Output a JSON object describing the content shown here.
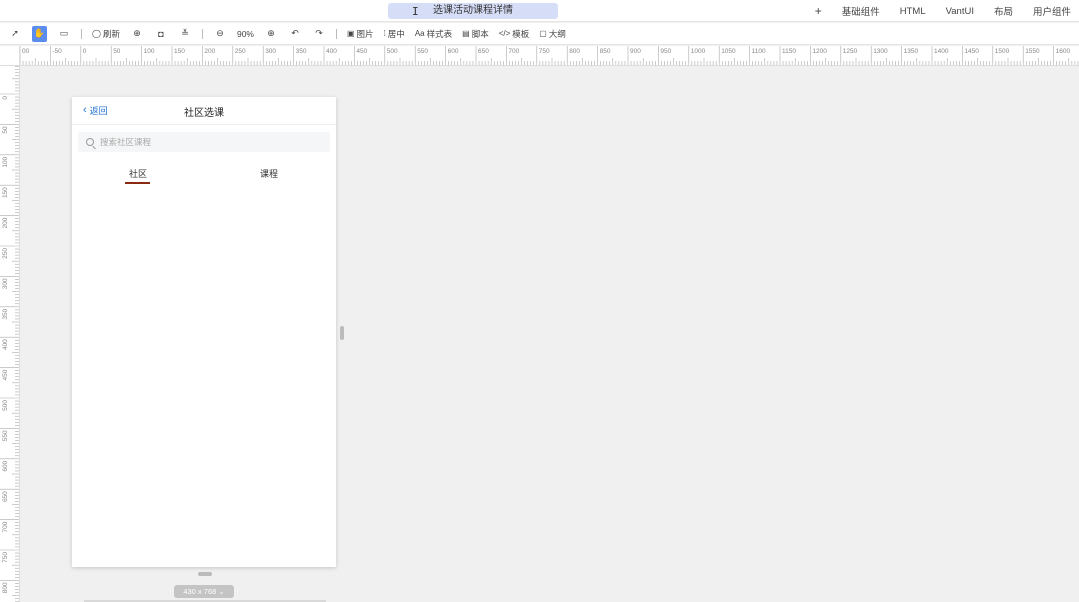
{
  "window": {
    "title": "选课活动课程详情"
  },
  "top_menu": {
    "add_label": "+",
    "items": [
      "基础组件",
      "HTML",
      "VantUI",
      "布局",
      "用户组件"
    ]
  },
  "toolbar": {
    "refresh_label": "刷新",
    "zoom_level": "90%",
    "image_label": "图片",
    "align_label": "居中",
    "style_label": "样式表",
    "script_label": "脚本",
    "template_label": "模板",
    "outline_label": "大纲"
  },
  "rulers": {
    "horizontal_labels": [
      "00",
      "-50",
      "0",
      "50",
      "100",
      "150",
      "200",
      "250",
      "300",
      "350",
      "400",
      "450",
      "500",
      "550",
      "600",
      "650",
      "700",
      "750",
      "800",
      "850",
      "900",
      "950",
      "1000",
      "1050",
      "1100",
      "1150",
      "1200",
      "1250",
      "1300",
      "1350",
      "1400",
      "1450",
      "1500",
      "1550",
      "1600"
    ],
    "vertical_labels": [
      "0",
      "50",
      "100",
      "150",
      "200",
      "250",
      "300",
      "350",
      "400",
      "450",
      "500",
      "550",
      "600",
      "650",
      "700",
      "750",
      "800"
    ]
  },
  "device": {
    "back_label": "返回",
    "page_title": "社区选课",
    "search_placeholder": "搜索社区课程",
    "tabs": [
      "社区",
      "课程"
    ],
    "active_tab": 0,
    "size_label": "430 x 768 ⌄"
  },
  "colors": {
    "title_pill": "#d6ddf7",
    "active_tool": "#5b8def",
    "link_blue": "#1f6fd1",
    "tab_indicator": "#8b2a12",
    "canvas_bg": "#f0f0f1"
  }
}
